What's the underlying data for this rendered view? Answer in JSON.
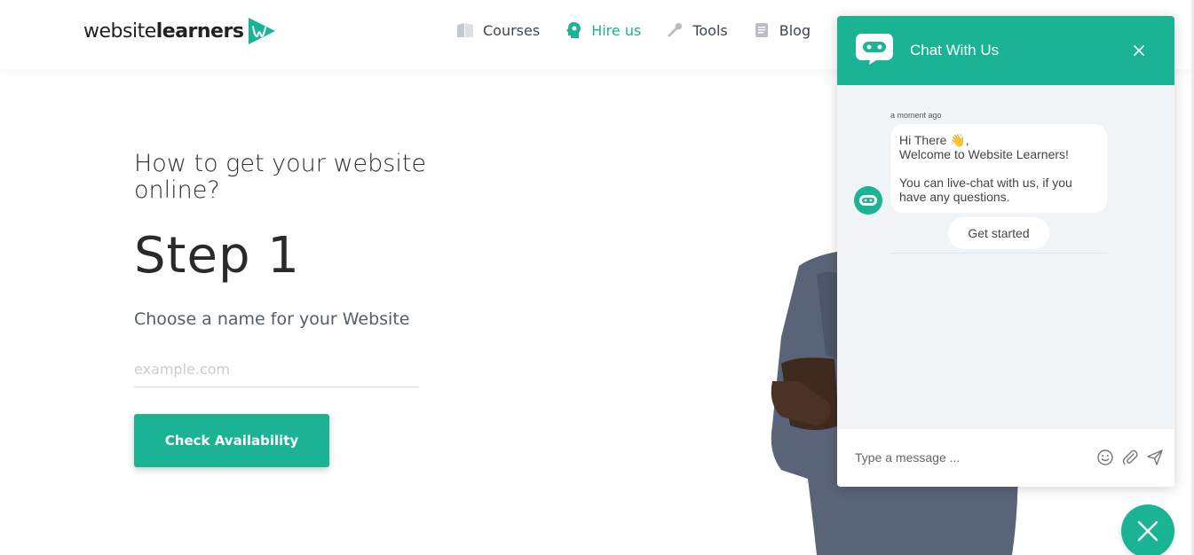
{
  "brand": {
    "name_light": "website",
    "name_bold": "learners",
    "accent": "#1ab394"
  },
  "nav": {
    "items": [
      {
        "label": "Courses",
        "icon": "book-icon",
        "active": false
      },
      {
        "label": "Hire us",
        "icon": "lightbulb-head-icon",
        "active": true
      },
      {
        "label": "Tools",
        "icon": "wrench-icon",
        "active": false
      },
      {
        "label": "Blog",
        "icon": "document-icon",
        "active": false
      }
    ]
  },
  "hero": {
    "question": "How to get your website online?",
    "step": "Step 1",
    "subtitle": "Choose a name for your Website",
    "domain_placeholder": "example.com",
    "domain_value": "",
    "button_label": "Check Availability"
  },
  "chat": {
    "title": "Chat With Us",
    "timestamp": "a moment ago",
    "message_line1": "Hi There 👋,",
    "message_line2": "Welcome to Website Learners!",
    "message_line3": "You can live-chat with us, if you have any questions.",
    "get_started_label": "Get started",
    "input_placeholder": "Type a message ...",
    "input_value": "",
    "icons": [
      "emoji-icon",
      "attachment-icon",
      "send-icon"
    ]
  }
}
